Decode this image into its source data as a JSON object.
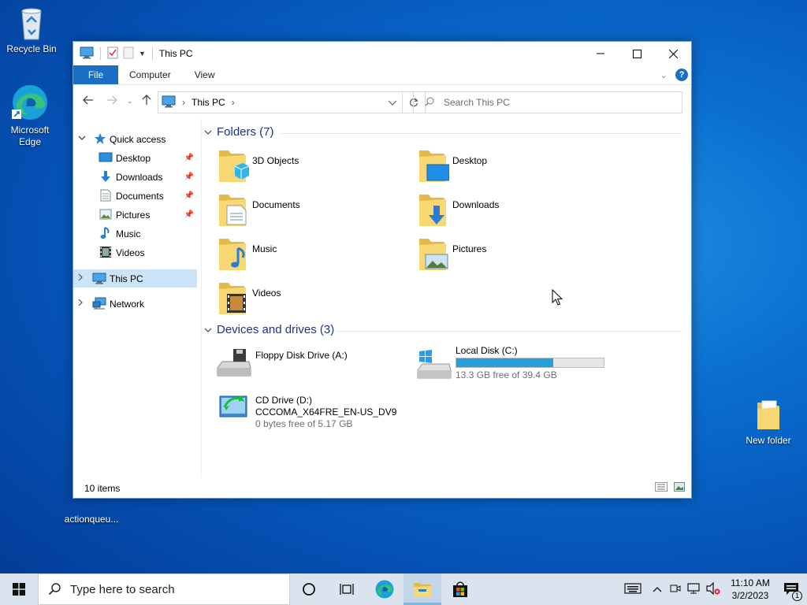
{
  "desktop": {
    "icons": [
      {
        "label": "Recycle Bin"
      },
      {
        "label": "Microsoft Edge"
      },
      {
        "label": "actionqueu..."
      },
      {
        "label": "New folder"
      }
    ]
  },
  "window": {
    "title": "This PC",
    "ribbon_tabs": [
      "File",
      "Computer",
      "View"
    ],
    "address": {
      "crumb": "This PC"
    },
    "search_placeholder": "Search This PC",
    "status_items": "10 items"
  },
  "nav_pane": {
    "quick_access": "Quick access",
    "pinned": [
      {
        "label": "Desktop",
        "icon": "desktop-icon"
      },
      {
        "label": "Downloads",
        "icon": "downloads-icon"
      },
      {
        "label": "Documents",
        "icon": "documents-icon"
      },
      {
        "label": "Pictures",
        "icon": "pictures-icon"
      }
    ],
    "others": [
      {
        "label": "Music",
        "icon": "music-icon"
      },
      {
        "label": "Videos",
        "icon": "videos-icon"
      }
    ],
    "this_pc": "This PC",
    "network": "Network"
  },
  "content": {
    "folders_header": "Folders (7)",
    "folders": [
      "3D Objects",
      "Desktop",
      "Documents",
      "Downloads",
      "Music",
      "Pictures",
      "Videos"
    ],
    "drives_header": "Devices and drives (3)",
    "drives": [
      {
        "name": "Floppy Disk Drive (A:)"
      },
      {
        "name": "Local Disk (C:)",
        "free": "13.3 GB free of 39.4 GB",
        "used_fraction": 0.66
      },
      {
        "name": "CD Drive (D:)",
        "label": "CCCOMA_X64FRE_EN-US_DV9",
        "free": "0 bytes free of 5.17 GB"
      }
    ]
  },
  "taskbar": {
    "search_placeholder": "Type here to search",
    "time": "11:10 AM",
    "date": "3/2/2023",
    "notification_count": "1"
  },
  "colors": {
    "accent": "#1a6fc4",
    "selection": "#cce4f7",
    "drive_bar": "#26a0da"
  }
}
